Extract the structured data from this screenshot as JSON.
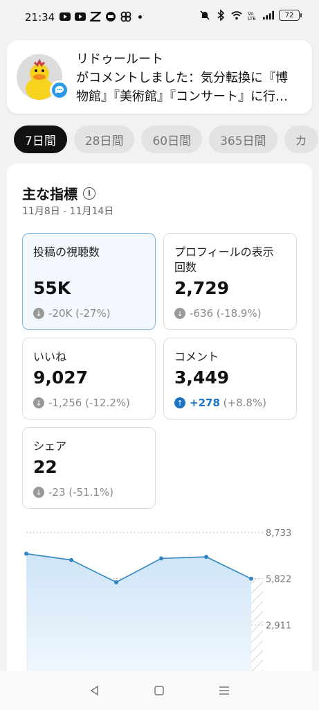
{
  "status_bar": {
    "time": "21:34",
    "battery": "72",
    "left_icons": [
      "youtube-icon",
      "youtube-icon",
      "app-icon",
      "app-icon",
      "fan-icon"
    ],
    "right_icons": [
      "mute-icon",
      "bluetooth-icon",
      "wifi-icon",
      "volte-icon",
      "signal-icon"
    ]
  },
  "notification": {
    "line1": "リドゥールート",
    "line2": "がコメントしました：気分転換に『博",
    "line3": "物館』『美術館』『コンサート』に行…"
  },
  "tabs": [
    {
      "label": "7日間",
      "active": true
    },
    {
      "label": "28日間",
      "active": false
    },
    {
      "label": "60日間",
      "active": false
    },
    {
      "label": "365日間",
      "active": false
    },
    {
      "label": "カ",
      "active": false
    }
  ],
  "card": {
    "title": "主な指標",
    "date_range": "11月8日 - 11月14日"
  },
  "metrics": {
    "views": {
      "label": "投稿の視聴数",
      "value": "55K",
      "change": "-20K (-27%)"
    },
    "profile": {
      "label_line1": "プロフィールの表示",
      "label_line2": "回数",
      "value": "2,729",
      "change": "-636 (-18.9%)"
    },
    "likes": {
      "label": "いいね",
      "value": "9,027",
      "change": "-1,256 (-12.2%)"
    },
    "comments": {
      "label": "コメント",
      "value": "3,449",
      "change_main": "+278",
      "change_pct": " (+8.8%)"
    },
    "shares": {
      "label": "シェア",
      "value": "22",
      "change": "-23 (-51.1%)"
    }
  },
  "chart_data": {
    "type": "area",
    "y_ticks": [
      "8,733",
      "5,822",
      "2,911"
    ],
    "ylim": [
      0,
      8733
    ],
    "values": [
      7400,
      7000,
      5600,
      7100,
      7200,
      5822
    ],
    "projected_hatched": true
  },
  "colors": {
    "accent_blue": "#1a73c7",
    "line": "#2f86c2",
    "area": "#cfe4f7"
  }
}
